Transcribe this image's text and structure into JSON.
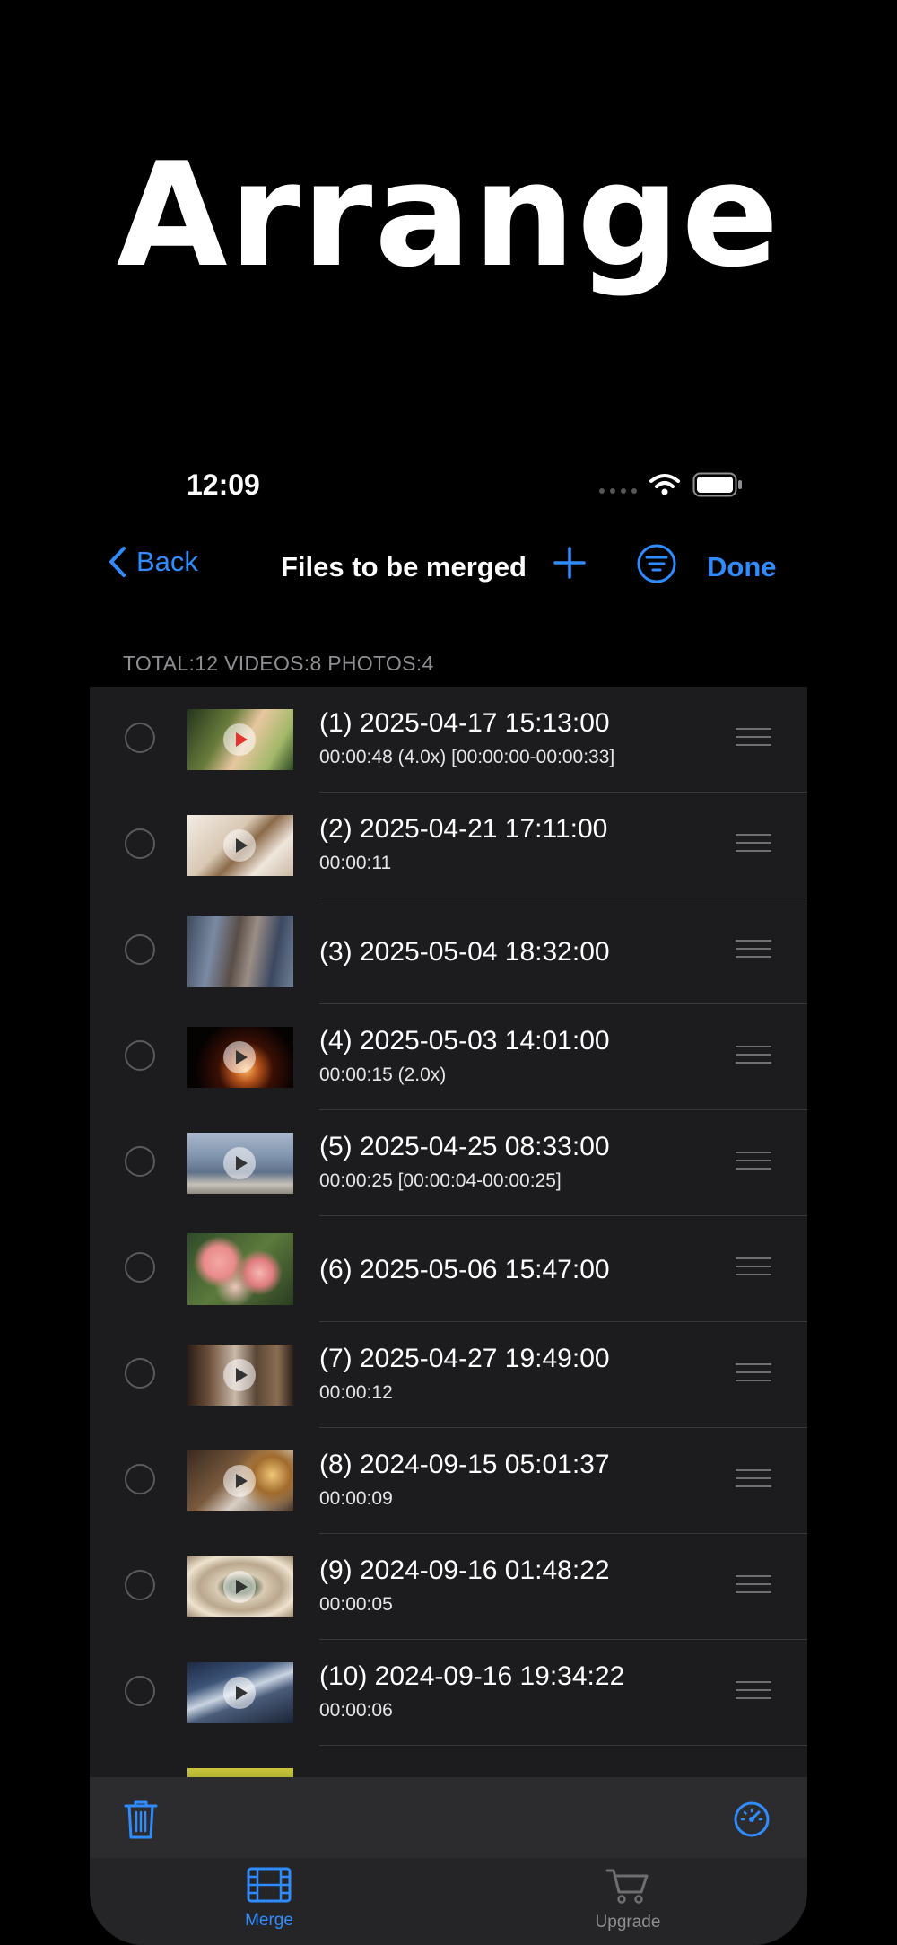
{
  "hero_title": "Arrange",
  "status": {
    "time": "12:09"
  },
  "nav": {
    "back_label": "Back",
    "title": "Files to be merged",
    "done_label": "Done"
  },
  "summary": "TOTAL:12 VIDEOS:8 PHOTOS:4",
  "items": [
    {
      "title": "(1) 2025-04-17 15:13:00",
      "subtitle": "00:00:48 (4.0x) [00:00:00-00:00:33]",
      "video": true
    },
    {
      "title": "(2) 2025-04-21 17:11:00",
      "subtitle": "00:00:11",
      "video": true
    },
    {
      "title": "(3) 2025-05-04 18:32:00",
      "subtitle": "",
      "video": false
    },
    {
      "title": "(4) 2025-05-03 14:01:00",
      "subtitle": "00:00:15 (2.0x)",
      "video": true
    },
    {
      "title": "(5) 2025-04-25 08:33:00",
      "subtitle": "00:00:25 [00:00:04-00:00:25]",
      "video": true
    },
    {
      "title": "(6) 2025-05-06 15:47:00",
      "subtitle": "",
      "video": false
    },
    {
      "title": "(7) 2025-04-27 19:49:00",
      "subtitle": "00:00:12",
      "video": true
    },
    {
      "title": "(8) 2024-09-15 05:01:37",
      "subtitle": "00:00:09",
      "video": true
    },
    {
      "title": "(9) 2024-09-16 01:48:22",
      "subtitle": "00:00:05",
      "video": true
    },
    {
      "title": "(10) 2024-09-16 19:34:22",
      "subtitle": "00:00:06",
      "video": true
    }
  ],
  "tabs": [
    {
      "label": "Merge",
      "active": true
    },
    {
      "label": "Upgrade",
      "active": false
    }
  ],
  "colors": {
    "accent": "#2f8cff",
    "background": "#000000",
    "row_bg": "#1c1c1e"
  },
  "icons": {
    "back": "chevron-left-icon",
    "add": "plus-icon",
    "filter": "filter-icon",
    "trash": "trash-icon",
    "speed": "speedometer-icon",
    "merge": "film-icon",
    "upgrade": "cart-icon",
    "reorder": "drag-handle-icon"
  }
}
